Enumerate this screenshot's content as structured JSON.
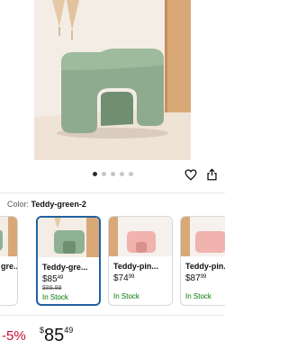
{
  "carousel": {
    "dot_count": 5,
    "active_index": 0
  },
  "color": {
    "label": "Color:",
    "selected": "Teddy-green-2"
  },
  "variants": [
    {
      "name": "gre...",
      "price_whole": "",
      "price_cents": "",
      "list_price": "",
      "stock": "",
      "thumb_color": "#8fb193"
    },
    {
      "name": "Teddy-gre...",
      "price_whole": "$85",
      "price_cents": "49",
      "list_price": "$89.99",
      "stock": "In Stock",
      "thumb_color": "#8fb193"
    },
    {
      "name": "Teddy-pin...",
      "price_whole": "$74",
      "price_cents": "99",
      "list_price": "",
      "stock": "In Stock",
      "thumb_color": "#f0b3ae"
    },
    {
      "name": "Teddy-pin...",
      "price_whole": "$87",
      "price_cents": "99",
      "list_price": "",
      "stock": "In Stock",
      "thumb_color": "#f0b3ae"
    }
  ],
  "price": {
    "discount": "-5%",
    "symbol": "$",
    "whole": "85",
    "cents": "49"
  },
  "colors": {
    "accent_blue": "#2162a1",
    "deal_red": "#cc0c39",
    "stock_green": "#007600"
  }
}
